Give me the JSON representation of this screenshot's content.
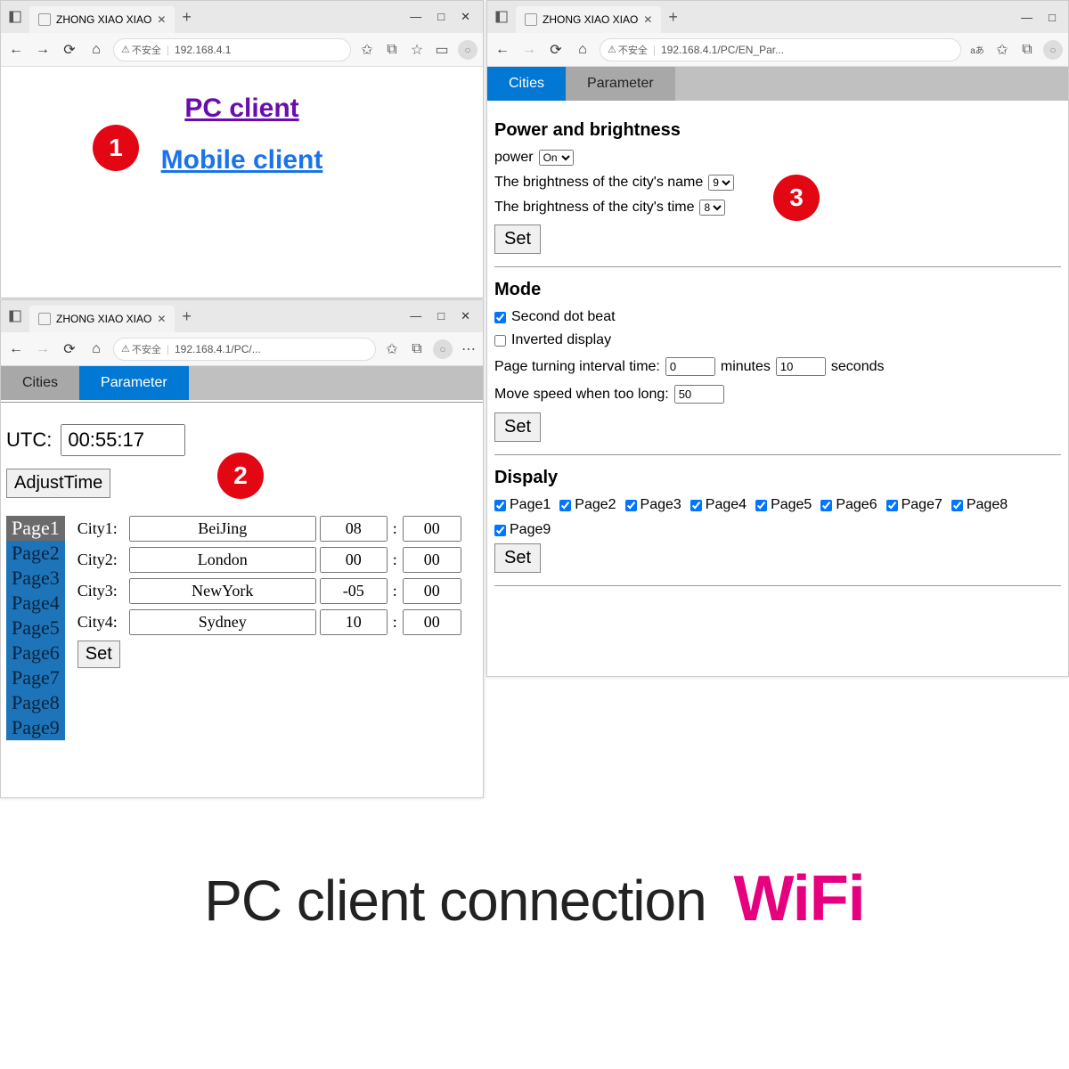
{
  "browser": {
    "tab_title": "ZHONG XIAO XIAO",
    "insecure_label": "不安全",
    "url1": "192.168.4.1",
    "url2": "192.168.4.1/PC/...",
    "url3": "192.168.4.1/PC/EN_Par..."
  },
  "win1": {
    "pc_link": "PC client",
    "mobile_link": "Mobile client"
  },
  "badges": {
    "b1": "1",
    "b2": "2",
    "b3": "3"
  },
  "tabs": {
    "cities": "Cities",
    "parameter": "Parameter"
  },
  "win2": {
    "utc_label": "UTC:",
    "utc_value": "00:55:17",
    "adjust": "AdjustTime",
    "pages": [
      "Page1",
      "Page2",
      "Page3",
      "Page4",
      "Page5",
      "Page6",
      "Page7",
      "Page8",
      "Page9"
    ],
    "city_labels": [
      "City1:",
      "City2:",
      "City3:",
      "City4:"
    ],
    "cities": [
      {
        "name": "BeiJing",
        "tz": "08",
        "min": "00"
      },
      {
        "name": "London",
        "tz": "00",
        "min": "00"
      },
      {
        "name": "NewYork",
        "tz": "-05",
        "min": "00"
      },
      {
        "name": "Sydney",
        "tz": "10",
        "min": "00"
      }
    ],
    "set": "Set"
  },
  "win3": {
    "h_power": "Power and brightness",
    "power_label": "power",
    "power_value": "On",
    "bright_name_label": "The brightness of the city's name",
    "bright_name_value": "9",
    "bright_time_label": "The brightness of the city's time",
    "bright_time_value": "8",
    "set": "Set",
    "h_mode": "Mode",
    "second_dot": "Second dot beat",
    "inverted": "Inverted display",
    "interval_label": "Page turning interval time:",
    "interval_min": "0",
    "minutes": "minutes",
    "interval_sec": "10",
    "seconds": "seconds",
    "movespeed_label": "Move speed when too long:",
    "movespeed": "50",
    "h_display": "Dispaly",
    "display_pages": [
      "Page1",
      "Page2",
      "Page3",
      "Page4",
      "Page5",
      "Page6",
      "Page7",
      "Page8",
      "Page9"
    ]
  },
  "caption": {
    "main": "PC client connection",
    "wifi": "WiFi"
  }
}
